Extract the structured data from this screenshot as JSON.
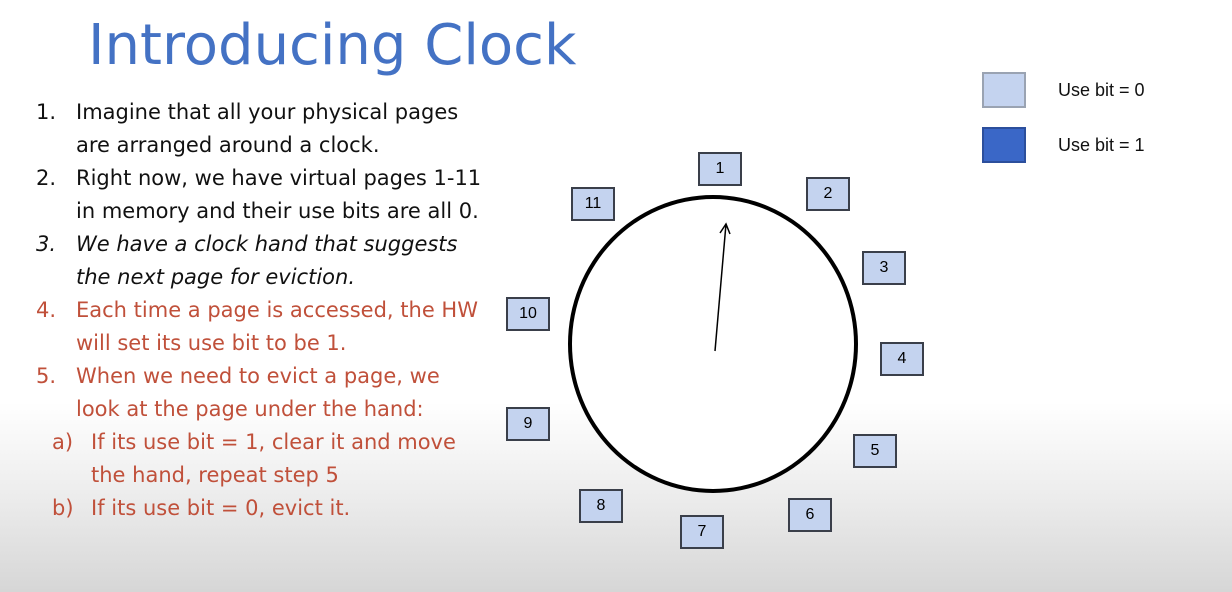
{
  "title": "Introducing Clock",
  "steps": [
    {
      "num": "1.",
      "text": "Imagine that all your physical pages are arranged around a clock."
    },
    {
      "num": "2.",
      "text": "Right now, we have virtual pages 1-11 in memory and their use bits are all 0."
    },
    {
      "num": "3.",
      "text": "We have a clock hand that suggests the next page for eviction."
    },
    {
      "num": "4.",
      "text": "Each time a page is accessed, the HW will set its use bit to be 1."
    },
    {
      "num": "5.",
      "text": "When we need to evict a page, we look at the page under the hand:"
    }
  ],
  "substeps": [
    {
      "num": "a)",
      "text": "If  its use bit = 1, clear it and move the hand, repeat step 5"
    },
    {
      "num": "b)",
      "text": "If its use bit = 0, evict it."
    }
  ],
  "pages": [
    "1",
    "2",
    "3",
    "4",
    "5",
    "6",
    "7",
    "8",
    "9",
    "10",
    "11"
  ],
  "page_use_bits": [
    0,
    0,
    0,
    0,
    0,
    0,
    0,
    0,
    0,
    0,
    0
  ],
  "legend": {
    "bit0_label": "Use bit = 0",
    "bit1_label": "Use bit = 1",
    "bit0_color": "#c4d3ef",
    "bit1_color": "#3a67c7"
  },
  "colors": {
    "title": "#4472c4",
    "highlight_text": "#c0503a"
  },
  "clock_hand_points_to": "1"
}
